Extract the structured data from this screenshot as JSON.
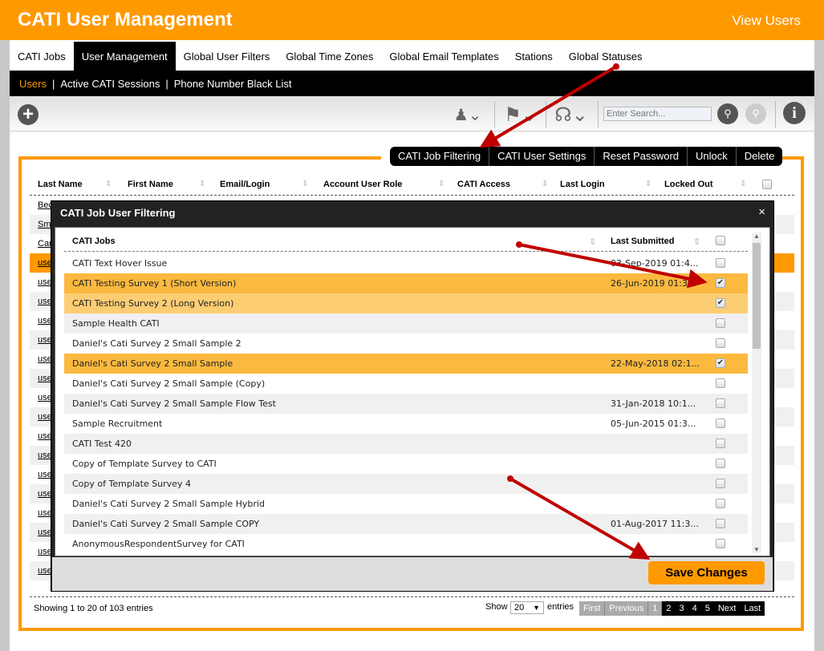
{
  "header": {
    "title": "CATI User Management",
    "view_users": "View Users"
  },
  "tabs": [
    "CATI Jobs",
    "User Management",
    "Global User Filters",
    "Global Time Zones",
    "Global Email Templates",
    "Stations",
    "Global Statuses"
  ],
  "subnav": [
    "Users",
    "Active CATI Sessions",
    "Phone Number Black List"
  ],
  "search": {
    "placeholder": "Enter Search..."
  },
  "actions": [
    "CATI Job Filtering",
    "CATI User Settings",
    "Reset Password",
    "Unlock",
    "Delete"
  ],
  "table": {
    "columns": [
      "Last Name",
      "First Name",
      "Email/Login",
      "Account User Role",
      "CATI Access",
      "Last Login",
      "Locked Out"
    ],
    "rows": [
      "Bec",
      "Sm",
      "Car",
      "use",
      "use",
      "use",
      "use",
      "use",
      "use",
      "use",
      "use",
      "use",
      "use",
      "use",
      "use",
      "use",
      "use",
      "use",
      "use",
      "use"
    ]
  },
  "footer": {
    "info": "Showing 1 to 20 of 103 entries",
    "show": "Show",
    "page_size": "20",
    "entries": "entries",
    "pager": [
      "First",
      "Previous",
      "1",
      "2",
      "3",
      "4",
      "5",
      "Next",
      "Last"
    ]
  },
  "modal": {
    "title": "CATI Job User Filtering",
    "close": "×",
    "col_jobs": "CATI Jobs",
    "col_last": "Last Submitted",
    "save": "Save Changes",
    "rows": [
      {
        "name": "CATI Text Hover Issue",
        "date": "03-Sep-2019 01:4...",
        "checked": false
      },
      {
        "name": "CATI Testing Survey 1 (Short Version)",
        "date": "26-Jun-2019 01:3...",
        "checked": true
      },
      {
        "name": "CATI Testing Survey 2 (Long Version)",
        "date": "",
        "checked": true
      },
      {
        "name": "Sample Health CATI",
        "date": "",
        "checked": false
      },
      {
        "name": "Daniel's Cati Survey 2 Small Sample 2",
        "date": "",
        "checked": false
      },
      {
        "name": "Daniel's Cati Survey 2 Small Sample",
        "date": "22-May-2018 02:1...",
        "checked": true
      },
      {
        "name": "Daniel's Cati Survey 2 Small Sample (Copy)",
        "date": "",
        "checked": false
      },
      {
        "name": "Daniel's Cati Survey 2 Small Sample Flow Test",
        "date": "31-Jan-2018 10:1...",
        "checked": false
      },
      {
        "name": "Sample Recruitment",
        "date": "05-Jun-2015 01:3...",
        "checked": false
      },
      {
        "name": "CATI Test 420",
        "date": "",
        "checked": false
      },
      {
        "name": "Copy of Template Survey to CATI",
        "date": "",
        "checked": false
      },
      {
        "name": "Copy of Template Survey 4",
        "date": "",
        "checked": false
      },
      {
        "name": "Daniel's Cati Survey 2 Small Sample Hybrid",
        "date": "",
        "checked": false
      },
      {
        "name": "Daniel's Cati Survey 2 Small Sample COPY",
        "date": "01-Aug-2017 11:3...",
        "checked": false
      },
      {
        "name": "AnonymousRespondentSurvey for CATI",
        "date": "",
        "checked": false
      }
    ]
  },
  "colors": {
    "accent": "#ff9900",
    "selected_row": "#fbb93f",
    "hover_row": "#fdcd73",
    "arrow": "#c00000"
  }
}
